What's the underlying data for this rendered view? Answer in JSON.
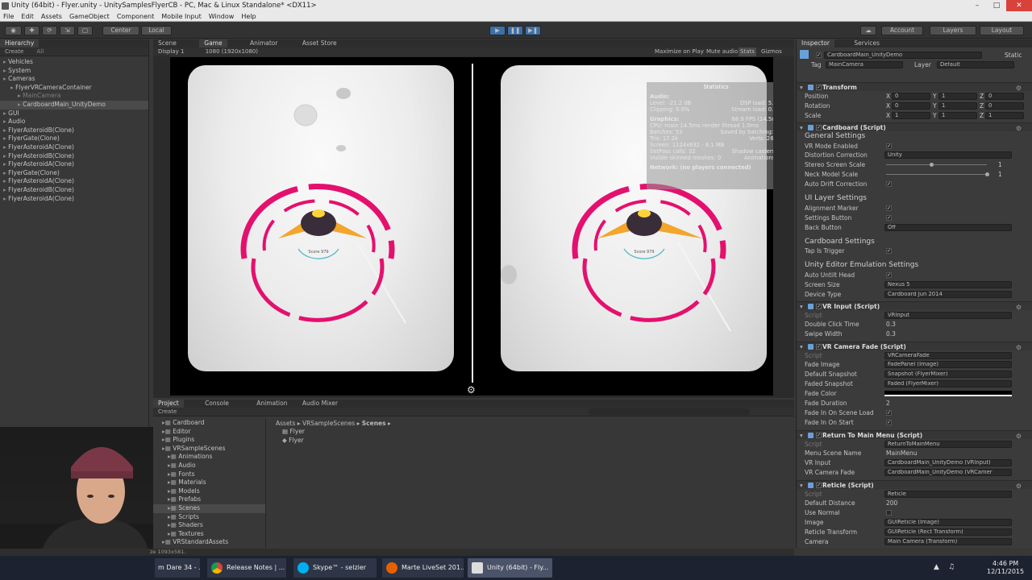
{
  "window": {
    "title": "Unity (64bit) - Flyer.unity - UnitySamplesFlyerCB - PC, Mac & Linux Standalone* <DX11>"
  },
  "menu": [
    "File",
    "Edit",
    "Assets",
    "GameObject",
    "Component",
    "Mobile Input",
    "Window",
    "Help"
  ],
  "toolbar": {
    "center": "Center",
    "local": "Local",
    "account": "Account",
    "layers": "Layers",
    "layout": "Layout"
  },
  "hierarchy": {
    "tab": "Hierarchy",
    "create": "Create",
    "search": "All",
    "items": [
      {
        "label": "Vehicles",
        "indent": 0,
        "state": "normal"
      },
      {
        "label": "System",
        "indent": 0,
        "state": "normal"
      },
      {
        "label": "Cameras",
        "indent": 0,
        "state": "normal"
      },
      {
        "label": "FlyerVRCameraContainer",
        "indent": 1,
        "state": "normal"
      },
      {
        "label": "MainCamera",
        "indent": 2,
        "state": "dim"
      },
      {
        "label": "CardboardMain_UnityDemo",
        "indent": 2,
        "state": "selected"
      },
      {
        "label": "GUI",
        "indent": 0,
        "state": "normal"
      },
      {
        "label": "Audio",
        "indent": 0,
        "state": "normal"
      },
      {
        "label": "FlyerAsteroidB(Clone)",
        "indent": 0,
        "state": "normal"
      },
      {
        "label": "FlyerGate(Clone)",
        "indent": 0,
        "state": "normal"
      },
      {
        "label": "FlyerAsteroidA(Clone)",
        "indent": 0,
        "state": "normal"
      },
      {
        "label": "FlyerAsteroidB(Clone)",
        "indent": 0,
        "state": "normal"
      },
      {
        "label": "FlyerAsteroidA(Clone)",
        "indent": 0,
        "state": "normal"
      },
      {
        "label": "FlyerGate(Clone)",
        "indent": 0,
        "state": "normal"
      },
      {
        "label": "FlyerAsteroidA(Clone)",
        "indent": 0,
        "state": "normal"
      },
      {
        "label": "FlyerAsteroidB(Clone)",
        "indent": 0,
        "state": "normal"
      },
      {
        "label": "FlyerAsteroidA(Clone)",
        "indent": 0,
        "state": "normal"
      }
    ]
  },
  "viewtabs": [
    "Scene",
    "Game",
    "Animator",
    "Asset Store"
  ],
  "gamebar": {
    "display": "Display 1",
    "resolution": "1080 (1920x1080)",
    "maximize": "Maximize on Play",
    "mute": "Mute audio",
    "stats": "Stats",
    "gizmos": "Gizmos"
  },
  "stats": {
    "title": "Statistics",
    "audio": "Audio:",
    "level": "Level: -21.2 dB",
    "clipping": "Clipping: 0.0%",
    "dsp": "DSP load: 5.3%",
    "stream": "Stream load: 0.1%",
    "graphics": "Graphics:",
    "fps": "68.9 FPS (14.5ms)",
    "cpu": "CPU: main 14.5ms  render thread 1.0ms",
    "batches": "Batches: 53",
    "saved": "Saved by batching: 10",
    "tris": "Tris: 17.2k",
    "verts": "Verts: 26.0k",
    "screen": "Screen: 1124x632 - 8.1 MB",
    "setpass": "SetPass calls: 32",
    "shadow": "Shadow casters: 0",
    "skinned": "Visible skinned meshes: 0",
    "animations": "Animations: 0",
    "network": "Network: (no players connected)"
  },
  "hud": {
    "score": "Score 979"
  },
  "projecttabs": [
    "Project",
    "Console",
    "Animation",
    "Audio Mixer"
  ],
  "project": {
    "create": "Create",
    "tree": [
      {
        "label": "Cardboard",
        "indent": 1
      },
      {
        "label": "Editor",
        "indent": 1
      },
      {
        "label": "Plugins",
        "indent": 1
      },
      {
        "label": "VRSampleScenes",
        "indent": 1
      },
      {
        "label": "Animations",
        "indent": 2
      },
      {
        "label": "Audio",
        "indent": 2
      },
      {
        "label": "Fonts",
        "indent": 2
      },
      {
        "label": "Materials",
        "indent": 2
      },
      {
        "label": "Models",
        "indent": 2
      },
      {
        "label": "Prefabs",
        "indent": 2
      },
      {
        "label": "Scenes",
        "indent": 2,
        "selected": true
      },
      {
        "label": "Scripts",
        "indent": 2
      },
      {
        "label": "Shaders",
        "indent": 2
      },
      {
        "label": "Textures",
        "indent": 2
      },
      {
        "label": "VRStandardAssets",
        "indent": 1
      }
    ],
    "breadcrumb": [
      "Assets",
      "VRSampleScenes",
      "Scenes"
    ],
    "files": [
      "Flyer",
      "Flyer"
    ]
  },
  "status": {
    "text": "ze 1093x581."
  },
  "inspector": {
    "tabs": [
      "Inspector",
      "Services"
    ],
    "object": "CardboardMain_UnityDemo",
    "static": "Static",
    "tag": "Tag",
    "tagval": "MainCamera",
    "layer": "Layer",
    "layerval": "Default",
    "transform": {
      "title": "Transform",
      "rows": [
        {
          "label": "Position",
          "x": "0",
          "y": "1",
          "z": "0"
        },
        {
          "label": "Rotation",
          "x": "0",
          "y": "1",
          "z": "0"
        },
        {
          "label": "Scale",
          "x": "1",
          "y": "1",
          "z": "1"
        }
      ]
    },
    "cardboard": {
      "title": "Cardboard (Script)",
      "general": "General Settings",
      "vrmode": "VR Mode Enabled",
      "distortion": "Distortion Correction",
      "distortionval": "Unity",
      "stereo": "Stereo Screen Scale",
      "stereoval": "1",
      "neck": "Neck Model Scale",
      "neckval": "1",
      "drift": "Auto Drift Correction",
      "uilayer": "UI Layer Settings",
      "alignment": "Alignment Marker",
      "settingsbtn": "Settings Button",
      "backbtn": "Back Button",
      "backbtnval": "Off",
      "cbsettings": "Cardboard Settings",
      "tap": "Tap Is Trigger",
      "emu": "Unity Editor Emulation Settings",
      "autountilt": "Auto Untilt Head",
      "screensize": "Screen Size",
      "screensizeval": "Nexus 5",
      "devicetype": "Device Type",
      "devicetypeval": "Cardboard Jun 2014"
    },
    "vrinput": {
      "title": "VR Input (Script)",
      "script": "Script",
      "scriptval": "VRInput",
      "dbl": "Double Click Time",
      "dblval": "0.3",
      "swipe": "Swipe Width",
      "swipeval": "0.3"
    },
    "camfade": {
      "title": "VR Camera Fade (Script)",
      "script": "Script",
      "scriptval": "VRCameraFade",
      "fadeimg": "Fade Image",
      "fadeimgval": "FadePanel (Image)",
      "defsnap": "Default Snapshot",
      "defsnapval": "Snapshot (FlyerMixer)",
      "fadedsnap": "Faded Snapshot",
      "fadedsnapval": "Faded (FlyerMixer)",
      "fadecolor": "Fade Color",
      "fadedur": "Fade Duration",
      "fadedurval": "2",
      "fadeinload": "Fade In On Scene Load",
      "fadeinstart": "Fade In On Start"
    },
    "returnmenu": {
      "title": "Return To Main Menu (Script)",
      "script": "Script",
      "scriptval": "ReturnToMainMenu",
      "scene": "Menu Scene Name",
      "sceneval": "MainMenu",
      "vrinput": "VR Input",
      "vrinputval": "CardboardMain_UnityDemo (VRInput)",
      "camfade": "VR Camera Fade",
      "camfadeval": "CardboardMain_UnityDemo (VRCamer"
    },
    "reticle": {
      "title": "Reticle (Script)",
      "script": "Script",
      "scriptval": "Reticle",
      "dist": "Default Distance",
      "distval": "200",
      "normal": "Use Normal",
      "image": "Image",
      "imageval": "GUIReticle (Image)",
      "rt": "Reticle Transform",
      "rtval": "GUIReticle (Rect Transform)",
      "camera": "Camera",
      "cameraval": "Main Camera (Transform)"
    }
  },
  "taskbar": {
    "items": [
      "m Dare 34 - ...",
      "Release Notes | ...",
      "Skype™ - selzier",
      "Marte LiveSet 201...",
      "Unity (64bit) - Fly..."
    ],
    "time": "4:46 PM",
    "date": "12/11/2015"
  },
  "colors": {
    "ring": "#e4106e",
    "panel": "#383838",
    "accent": "#3d6fa8"
  }
}
